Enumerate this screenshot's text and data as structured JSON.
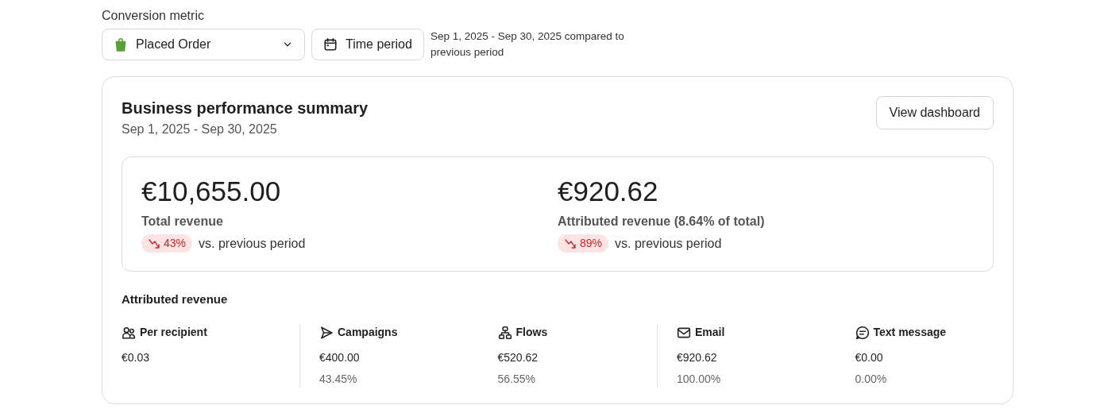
{
  "filter": {
    "label": "Conversion metric",
    "metric": "Placed Order",
    "period_button": "Time period",
    "period_text": "Sep 1, 2025 - Sep 30, 2025 compared to previous period"
  },
  "summary": {
    "title": "Business performance summary",
    "subtitle": "Sep 1, 2025 - Sep 30, 2025",
    "button": "View dashboard",
    "kpis": [
      {
        "value": "€10,655.00",
        "label": "Total revenue",
        "decrease": true,
        "change": "43%",
        "comparison": "vs. previous period"
      },
      {
        "value": "€920.62",
        "label": "Attributed revenue (8.64% of total)",
        "decrease": true,
        "change": "89%",
        "comparison": "vs. previous period"
      }
    ],
    "attributed": {
      "title": "Attributed revenue",
      "groups": [
        {
          "items": [
            {
              "label": "Per recipient",
              "value": "€0.03"
            }
          ]
        },
        {
          "items": [
            {
              "label": "Campaigns",
              "value": "€400.00",
              "share": "43.45%"
            },
            {
              "label": "Flows",
              "value": "€520.62",
              "share": "56.55%"
            }
          ]
        },
        {
          "items": [
            {
              "label": "Email",
              "value": "€920.62",
              "share": "100.00%"
            },
            {
              "label": "Text message",
              "value": "€0.00",
              "share": "0.00%"
            }
          ]
        }
      ]
    }
  }
}
